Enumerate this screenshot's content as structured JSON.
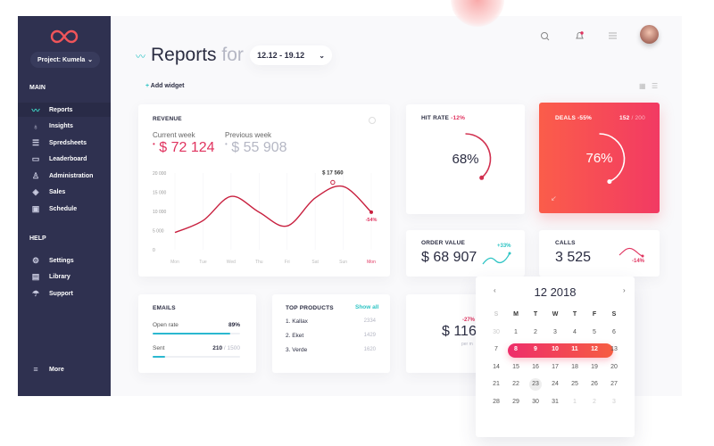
{
  "colors": {
    "sidebar": "#2f3150",
    "accent_red": "#e0335f",
    "accent_teal": "#2ec4c4",
    "deals_gradient": [
      "#fb5d4a",
      "#f23a63"
    ]
  },
  "sidebar": {
    "logo": "infinity-logo",
    "project": "Project: Kumela",
    "main_label": "MAIN",
    "help_label": "HELP",
    "main_items": [
      {
        "label": "Reports",
        "icon": "pulse-icon",
        "active": true
      },
      {
        "label": "Insights",
        "icon": "lightbulb-icon"
      },
      {
        "label": "Spredsheets",
        "icon": "list-icon"
      },
      {
        "label": "Leaderboard",
        "icon": "monitor-icon"
      },
      {
        "label": "Administration",
        "icon": "user-icon"
      },
      {
        "label": "Sales",
        "icon": "tag-icon"
      },
      {
        "label": "Schedule",
        "icon": "calendar-icon"
      }
    ],
    "help_items": [
      {
        "label": "Settings",
        "icon": "gear-icon"
      },
      {
        "label": "Library",
        "icon": "book-icon"
      },
      {
        "label": "Support",
        "icon": "umbrella-icon"
      }
    ],
    "more": "More"
  },
  "header": {
    "title": "Reports",
    "for": "for",
    "date_range": "12.12 - 19.12",
    "add_widget": "Add widget"
  },
  "revenue": {
    "title": "REVENUE",
    "current_label": "Current week",
    "current_value": "$ 72 124",
    "previous_label": "Previous week",
    "previous_value": "$ 55 908",
    "peak_label": "$ 17 560",
    "change": "-54%"
  },
  "chart_data": {
    "type": "line",
    "categories": [
      "Mon",
      "Tue",
      "Wed",
      "Thu",
      "Fri",
      "Sat",
      "Sun",
      "Mon"
    ],
    "values": [
      4500,
      7600,
      13900,
      9800,
      6200,
      13500,
      16500,
      9800
    ],
    "yticks": [
      "20 000",
      "15 000",
      "10 000",
      "5 000",
      "0"
    ],
    "ylim": [
      0,
      20000
    ],
    "peak": 17560,
    "highlight_category": "Mon"
  },
  "hit_rate": {
    "title": "HIT RATE",
    "change": "-12%",
    "value": "68%",
    "fraction": 0.68
  },
  "deals": {
    "title": "DEALS",
    "change": "-55%",
    "count": "152",
    "total": "/ 200",
    "value": "76%",
    "fraction": 0.76
  },
  "order_value": {
    "title": "ORDER VALUE",
    "value": "$ 68 907",
    "change": "+33%"
  },
  "calls": {
    "title": "CALLS",
    "value": "3 525",
    "change": "-14%"
  },
  "emails": {
    "title": "EMAILS",
    "open_label": "Open rate",
    "open_value": "89%",
    "open_fraction": 0.89,
    "sent_label": "Sent",
    "sent_value": "210",
    "sent_total": "/ 1500",
    "sent_fraction": 0.14
  },
  "top_products": {
    "title": "TOP PRODUCTS",
    "show_all": "Show all",
    "items": [
      {
        "name": "1. Kallax",
        "value": "2334"
      },
      {
        "name": "2. Eket",
        "value": "1429"
      },
      {
        "name": "3. Verde",
        "value": "1620"
      }
    ]
  },
  "avg": {
    "change": "-27%",
    "value": "$ 116 .",
    "sub": "per m"
  },
  "calendar": {
    "title": "12 2018",
    "days": [
      "S",
      "M",
      "T",
      "W",
      "T",
      "F",
      "S"
    ],
    "dates": [
      [
        "30",
        true
      ],
      [
        "1"
      ],
      [
        "2"
      ],
      [
        "3"
      ],
      [
        "4"
      ],
      [
        "5"
      ],
      [
        "6"
      ],
      [
        "7"
      ],
      [
        "8",
        false,
        true
      ],
      [
        "9",
        false,
        true
      ],
      [
        "10",
        false,
        true
      ],
      [
        "11",
        false,
        true
      ],
      [
        "12",
        false,
        true
      ],
      [
        "13"
      ],
      [
        "14"
      ],
      [
        "15"
      ],
      [
        "16"
      ],
      [
        "17"
      ],
      [
        "18"
      ],
      [
        "19"
      ],
      [
        "20"
      ],
      [
        "21"
      ],
      [
        "22"
      ],
      [
        "23",
        false,
        false,
        true
      ],
      [
        "24"
      ],
      [
        "25"
      ],
      [
        "26"
      ],
      [
        "27"
      ],
      [
        "28"
      ],
      [
        "29"
      ],
      [
        "30"
      ],
      [
        "31"
      ],
      [
        "1",
        true
      ],
      [
        "2",
        true
      ],
      [
        "3",
        true
      ]
    ]
  }
}
